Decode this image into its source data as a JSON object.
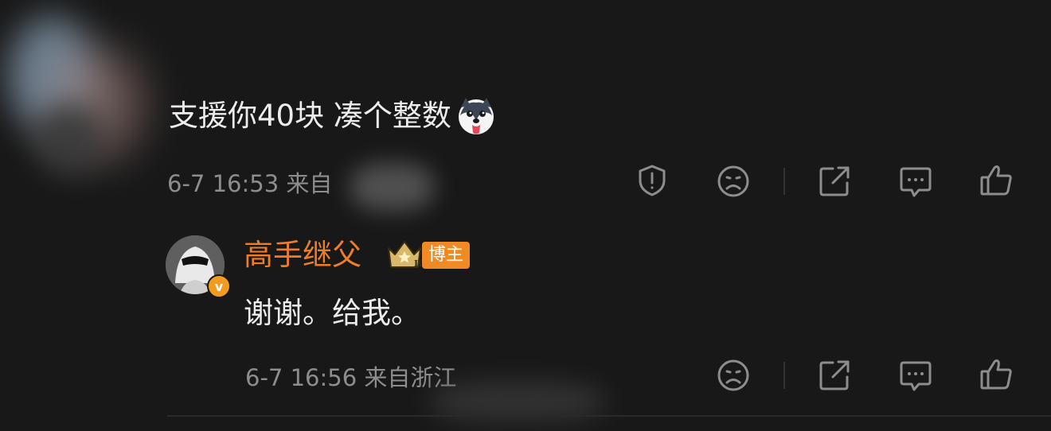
{
  "comment": {
    "text": "支援你40块 凑个整数",
    "emoji": "husky-dog-tongue-emoji",
    "timestamp": "6-7 16:53",
    "location_prefix": "来自"
  },
  "reply": {
    "author_name": "高手继父",
    "verified_mark": "v",
    "crown_level": "II",
    "badge_label": "博主",
    "text": "谢谢。给我。",
    "timestamp": "6-7 16:56",
    "location": "来自浙江"
  },
  "colors": {
    "background": "#181818",
    "text": "#ececec",
    "meta": "#8d8d8d",
    "author_name": "#f07c2a",
    "badge": "#f08a24",
    "verified": "#f29c1f"
  }
}
